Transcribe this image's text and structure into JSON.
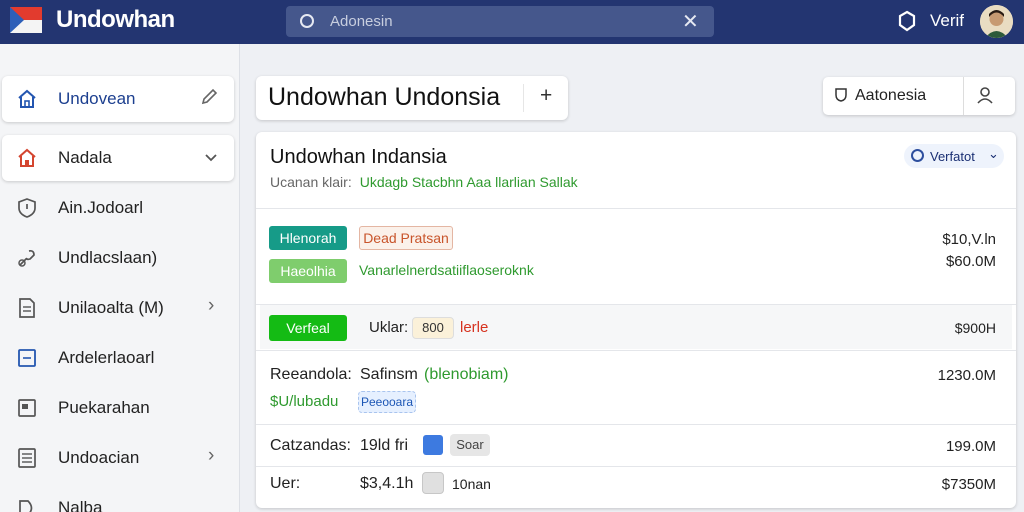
{
  "app": {
    "brand": "Undowhan",
    "user_name": "Verif",
    "colors": {
      "topbar": "#233571",
      "accent_green": "#14bb14",
      "teal": "#169b88",
      "link_blue": "#1a2f73"
    }
  },
  "search": {
    "value": "Adonesin",
    "icon": "search-icon",
    "clear_icon": "close-icon"
  },
  "sidebar": {
    "items": [
      {
        "label": "Undovean",
        "icon": "home-icon",
        "trail_icon": "edit-icon"
      },
      {
        "label": "Nadala",
        "icon": "home-icon",
        "trail_icon": "chevron-down-icon"
      },
      {
        "label": "Ain.Jodoarl",
        "icon": "shield-icon"
      },
      {
        "label": "Undlacslaan)",
        "icon": "link-icon"
      },
      {
        "label": "Unilaoalta (M)",
        "icon": "document-icon",
        "trail_icon": "chevron-right-icon"
      },
      {
        "label": "Ardelerlaoarl",
        "icon": "calendar-icon"
      },
      {
        "label": "Puekarahan",
        "icon": "folder-icon"
      },
      {
        "label": "Undoacian",
        "icon": "list-icon",
        "trail_icon": "chevron-right-icon"
      },
      {
        "label": "Nalba",
        "icon": "tag-icon"
      }
    ]
  },
  "header": {
    "title": "Undowhan Undonsia",
    "add_label": "+",
    "filter_label": "Aatonesia"
  },
  "panel": {
    "title": "Undowhan Indansia",
    "sub_label": "Ucanan klair:",
    "sub_value": "Ukdagb Stacbhn Aaa llarlian Sallak",
    "status_label": "Verfatot",
    "rows": {
      "r1": {
        "badge": "Hlenorah",
        "outline_badge": "Dead Pratsan",
        "amount": "$10,V.ln"
      },
      "r2": {
        "badge": "Haeolhia",
        "text": "Vanarlelnerdsatiiflaoseroknk",
        "amount": "$60.0M"
      },
      "r3": {
        "badge": "Verfeal",
        "label": "Uklar:",
        "chip": "800",
        "text": "lerle",
        "amount": "$900H"
      },
      "r4": {
        "label": "Reeandola:",
        "value": "Safinsm",
        "value2": "(blenobiam)",
        "amount": "1230.0M",
        "green_label": "$U/lubadu",
        "chip": "Peeooara"
      },
      "r5": {
        "label": "Catzandas:",
        "value": "19ld fri",
        "chip": "Soar",
        "amount": "199.0M"
      },
      "r6": {
        "label": "Uer:",
        "value": "$3,4.1h",
        "chip": "10nan",
        "amount": "$7350M"
      }
    }
  }
}
